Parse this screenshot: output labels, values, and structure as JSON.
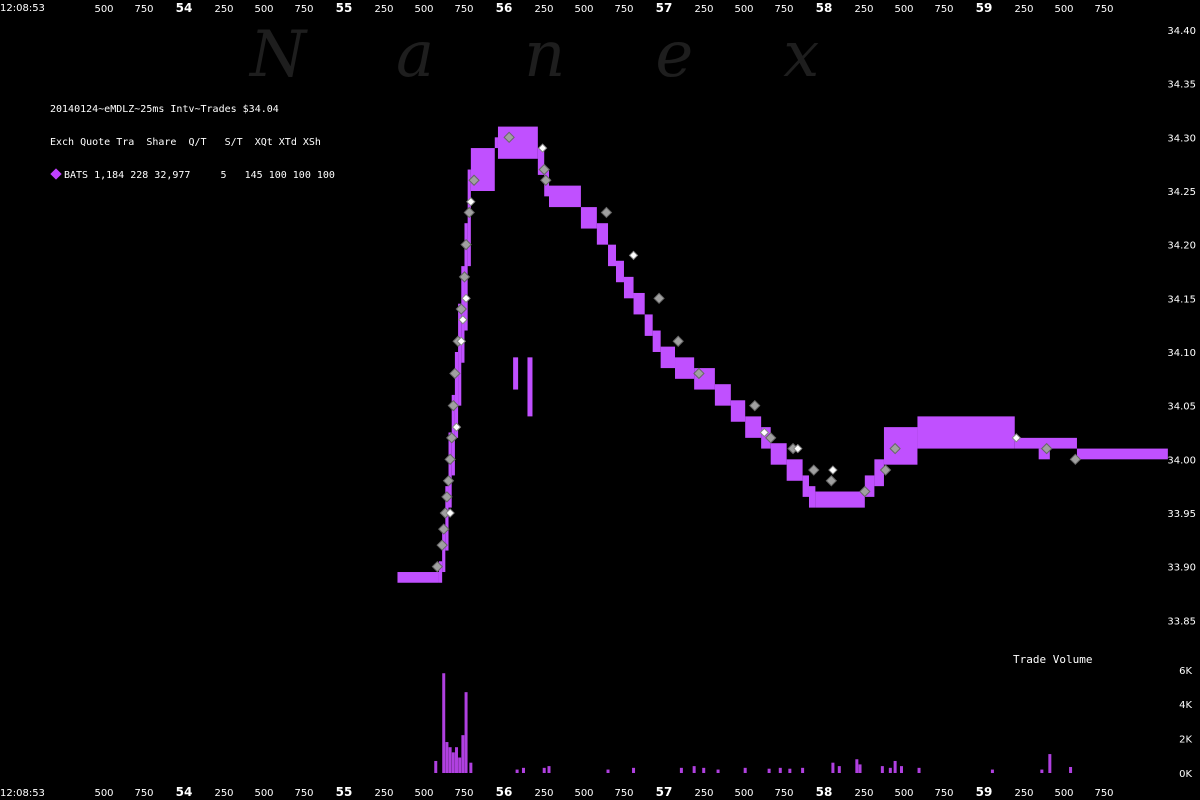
{
  "watermark": "Nanex",
  "time_label": "12:08:53",
  "legend": {
    "line1": "20140124~eMDLZ~25ms Intv~Trades $34.04",
    "line2": "Exch Quote Tra  Share  Q/T   S/T  XQt XTd XSh",
    "line3": "BATS 1,184 228 32,977     5   145 100 100 100"
  },
  "volume_title": "Trade Volume",
  "colors": {
    "quote": "#c050ff",
    "volume": "#b040e0",
    "trade_grey": "#a0a0a0",
    "trade_white": "#ffffff",
    "background": "#000000"
  },
  "x_ticks": [
    {
      "label": "500",
      "bold": false
    },
    {
      "label": "750",
      "bold": false
    },
    {
      "label": "54",
      "bold": true
    },
    {
      "label": "250",
      "bold": false
    },
    {
      "label": "500",
      "bold": false
    },
    {
      "label": "750",
      "bold": false
    },
    {
      "label": "55",
      "bold": true
    },
    {
      "label": "250",
      "bold": false
    },
    {
      "label": "500",
      "bold": false
    },
    {
      "label": "750",
      "bold": false
    },
    {
      "label": "56",
      "bold": true
    },
    {
      "label": "250",
      "bold": false
    },
    {
      "label": "500",
      "bold": false
    },
    {
      "label": "750",
      "bold": false
    },
    {
      "label": "57",
      "bold": true
    },
    {
      "label": "250",
      "bold": false
    },
    {
      "label": "500",
      "bold": false
    },
    {
      "label": "750",
      "bold": false
    },
    {
      "label": "58",
      "bold": true
    },
    {
      "label": "250",
      "bold": false
    },
    {
      "label": "500",
      "bold": false
    },
    {
      "label": "750",
      "bold": false
    },
    {
      "label": "59",
      "bold": true
    },
    {
      "label": "250",
      "bold": false
    },
    {
      "label": "500",
      "bold": false
    },
    {
      "label": "750",
      "bold": false
    }
  ],
  "chart_data": {
    "type": "line",
    "title": "20140124~eMDLZ~25ms Intv~Trades $34.04",
    "xlabel": "",
    "ylabel": "",
    "xlim": [
      53.25,
      59.9
    ],
    "ylim": [
      33.8,
      34.4
    ],
    "y_ticks": [
      "34.40",
      "34.35",
      "34.30",
      "34.25",
      "34.20",
      "34.15",
      "34.10",
      "34.05",
      "34.00",
      "33.95",
      "33.90",
      "33.85"
    ],
    "quote_band": [
      [
        55.09,
        55.35,
        33.895,
        33.885
      ],
      [
        55.35,
        55.37,
        33.905,
        33.885
      ],
      [
        55.37,
        55.39,
        33.935,
        33.895
      ],
      [
        55.39,
        55.41,
        33.975,
        33.915
      ],
      [
        55.41,
        55.43,
        34.025,
        33.955
      ],
      [
        55.43,
        55.45,
        34.06,
        33.985
      ],
      [
        55.45,
        55.47,
        34.1,
        34.02
      ],
      [
        55.47,
        55.49,
        34.145,
        34.05
      ],
      [
        55.49,
        55.51,
        34.18,
        34.09
      ],
      [
        55.51,
        55.53,
        34.22,
        34.12
      ],
      [
        55.53,
        55.55,
        34.27,
        34.18
      ],
      [
        55.55,
        55.7,
        34.29,
        34.25
      ],
      [
        55.7,
        55.72,
        34.3,
        34.29
      ],
      [
        55.72,
        55.97,
        34.31,
        34.28
      ],
      [
        55.97,
        56.01,
        34.29,
        34.265
      ],
      [
        56.01,
        56.04,
        34.27,
        34.245
      ],
      [
        56.04,
        56.24,
        34.255,
        34.235
      ],
      [
        56.24,
        56.34,
        34.235,
        34.215
      ],
      [
        56.34,
        56.41,
        34.22,
        34.2
      ],
      [
        56.41,
        56.46,
        34.2,
        34.18
      ],
      [
        56.46,
        56.51,
        34.185,
        34.165
      ],
      [
        56.51,
        56.57,
        34.17,
        34.15
      ],
      [
        56.57,
        56.64,
        34.155,
        34.135
      ],
      [
        56.64,
        56.69,
        34.135,
        34.115
      ],
      [
        56.69,
        56.74,
        34.12,
        34.1
      ],
      [
        56.74,
        56.83,
        34.105,
        34.085
      ],
      [
        56.83,
        56.95,
        34.095,
        34.075
      ],
      [
        56.95,
        57.08,
        34.085,
        34.065
      ],
      [
        57.08,
        57.18,
        34.07,
        34.05
      ],
      [
        57.18,
        57.27,
        34.055,
        34.035
      ],
      [
        57.27,
        57.37,
        34.04,
        34.02
      ],
      [
        57.37,
        57.43,
        34.03,
        34.01
      ],
      [
        57.43,
        57.53,
        34.015,
        33.995
      ],
      [
        57.53,
        57.63,
        34.0,
        33.98
      ],
      [
        57.63,
        57.67,
        33.985,
        33.965
      ],
      [
        57.67,
        57.71,
        33.975,
        33.955
      ],
      [
        57.71,
        58.02,
        33.97,
        33.955
      ],
      [
        58.02,
        58.08,
        33.985,
        33.965
      ],
      [
        58.08,
        58.14,
        34.0,
        33.975
      ],
      [
        58.14,
        58.35,
        34.03,
        33.995
      ],
      [
        58.35,
        58.96,
        34.04,
        34.01
      ],
      [
        58.96,
        59.35,
        34.02,
        34.01
      ],
      [
        59.11,
        59.18,
        34.01,
        34.0
      ],
      [
        59.35,
        59.92,
        34.01,
        34.0
      ]
    ],
    "quote_spike": [
      {
        "x": 55.905,
        "y": [
          34.095,
          34.04
        ]
      },
      {
        "x": 55.815,
        "y": [
          34.095,
          34.065
        ]
      }
    ],
    "trades_grey": [
      [
        55.34,
        33.9
      ],
      [
        55.37,
        33.92
      ],
      [
        55.38,
        33.935
      ],
      [
        55.39,
        33.95
      ],
      [
        55.4,
        33.965
      ],
      [
        55.41,
        33.98
      ],
      [
        55.42,
        34.0
      ],
      [
        55.43,
        34.02
      ],
      [
        55.44,
        34.05
      ],
      [
        55.45,
        34.08
      ],
      [
        55.47,
        34.11
      ],
      [
        55.49,
        34.14
      ],
      [
        55.51,
        34.17
      ],
      [
        55.52,
        34.2
      ],
      [
        55.54,
        34.23
      ],
      [
        55.57,
        34.26
      ],
      [
        55.79,
        34.3
      ],
      [
        56.01,
        34.27
      ],
      [
        56.02,
        34.26
      ],
      [
        56.4,
        34.23
      ],
      [
        56.73,
        34.15
      ],
      [
        56.85,
        34.11
      ],
      [
        56.98,
        34.08
      ],
      [
        57.33,
        34.05
      ],
      [
        57.43,
        34.02
      ],
      [
        57.57,
        34.01
      ],
      [
        57.7,
        33.99
      ],
      [
        57.81,
        33.98
      ],
      [
        58.02,
        33.97
      ],
      [
        58.15,
        33.99
      ],
      [
        58.21,
        34.01
      ],
      [
        59.16,
        34.01
      ],
      [
        59.34,
        34.0
      ]
    ],
    "trades_white": [
      [
        55.42,
        33.95
      ],
      [
        55.46,
        34.03
      ],
      [
        55.49,
        34.11
      ],
      [
        55.5,
        34.13
      ],
      [
        55.52,
        34.15
      ],
      [
        55.55,
        34.24
      ],
      [
        56.0,
        34.29
      ],
      [
        56.57,
        34.19
      ],
      [
        57.39,
        34.025
      ],
      [
        57.6,
        34.01
      ],
      [
        57.82,
        33.99
      ],
      [
        58.97,
        34.02
      ]
    ],
    "volume": {
      "ylim": [
        0,
        7000
      ],
      "y_ticks": [
        "6K",
        "4K",
        "2K",
        "0K"
      ],
      "bars": [
        [
          55.33,
          700
        ],
        [
          55.38,
          5800
        ],
        [
          55.4,
          1800
        ],
        [
          55.42,
          1500
        ],
        [
          55.44,
          1200
        ],
        [
          55.46,
          1500
        ],
        [
          55.48,
          900
        ],
        [
          55.5,
          2200
        ],
        [
          55.52,
          4700
        ],
        [
          55.55,
          600
        ],
        [
          55.84,
          200
        ],
        [
          55.88,
          300
        ],
        [
          56.01,
          300
        ],
        [
          56.04,
          400
        ],
        [
          56.41,
          200
        ],
        [
          56.57,
          300
        ],
        [
          56.87,
          300
        ],
        [
          56.95,
          400
        ],
        [
          57.01,
          300
        ],
        [
          57.1,
          200
        ],
        [
          57.27,
          300
        ],
        [
          57.42,
          250
        ],
        [
          57.49,
          300
        ],
        [
          57.55,
          250
        ],
        [
          57.63,
          300
        ],
        [
          57.82,
          600
        ],
        [
          57.86,
          400
        ],
        [
          57.97,
          800
        ],
        [
          57.99,
          500
        ],
        [
          58.13,
          400
        ],
        [
          58.18,
          300
        ],
        [
          58.21,
          700
        ],
        [
          58.25,
          400
        ],
        [
          58.36,
          300
        ],
        [
          58.82,
          200
        ],
        [
          59.13,
          200
        ],
        [
          59.18,
          1100
        ],
        [
          59.31,
          350
        ]
      ]
    },
    "grid": false,
    "legend": "top-left"
  }
}
